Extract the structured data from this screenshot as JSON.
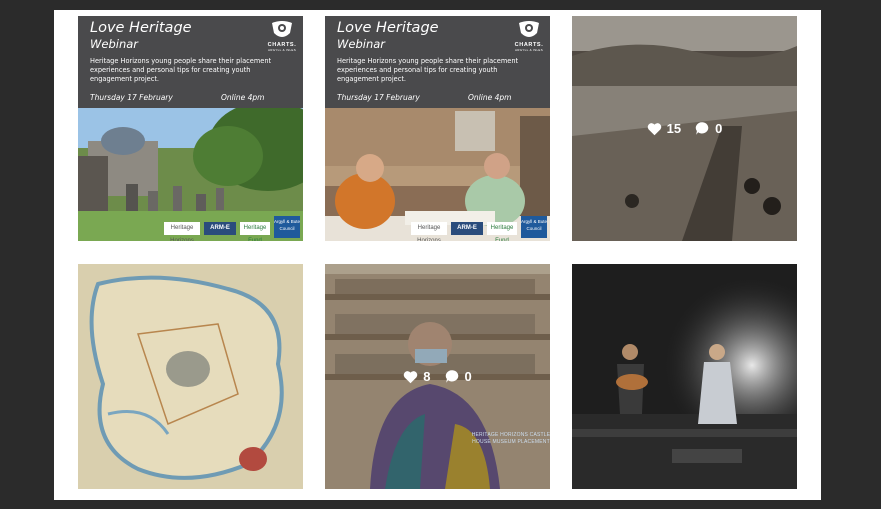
{
  "feed": {
    "tiles": [
      {
        "type": "webinar",
        "title": "Love Heritage",
        "subtitle": "Webinar",
        "description": "Heritage Horizons young people share their placement experiences and personal tips for creating youth engagement project.",
        "date": "Thursday 17 February",
        "time": "Online 4pm",
        "logo_text": "CHARTS.",
        "logo_subtext": "ARGYLL & ISLES",
        "partners": [
          "Heritage Horizons",
          "ARM-E",
          "Heritage Fund",
          "Argyll & Bute Council"
        ]
      },
      {
        "type": "webinar",
        "title": "Love Heritage",
        "subtitle": "Webinar",
        "description": "Heritage Horizons young people share their placement experiences and personal tips for creating youth engagement project.",
        "date": "Thursday 17 February",
        "time": "Online 4pm",
        "logo_text": "CHARTS.",
        "logo_subtext": "ARGYLL & ISLES",
        "partners": [
          "Heritage Horizons",
          "ARM-E",
          "Heritage Fund",
          "Argyll & Bute Council"
        ]
      },
      {
        "type": "photo",
        "likes": "15",
        "comments": "0"
      },
      {
        "type": "photo"
      },
      {
        "type": "photo",
        "likes": "8",
        "comments": "0",
        "overlay_text": "HERITAGE HORIZONS CASTLE HOUSE MUSEUM PLACEMENT"
      },
      {
        "type": "photo"
      }
    ]
  },
  "colors": {
    "page_bg": "#2b2b2b",
    "panel_bg": "#ffffff",
    "header_bg": "#4a4a4c"
  },
  "icons": [
    "heart-icon",
    "comment-icon",
    "charts-logo-icon"
  ]
}
